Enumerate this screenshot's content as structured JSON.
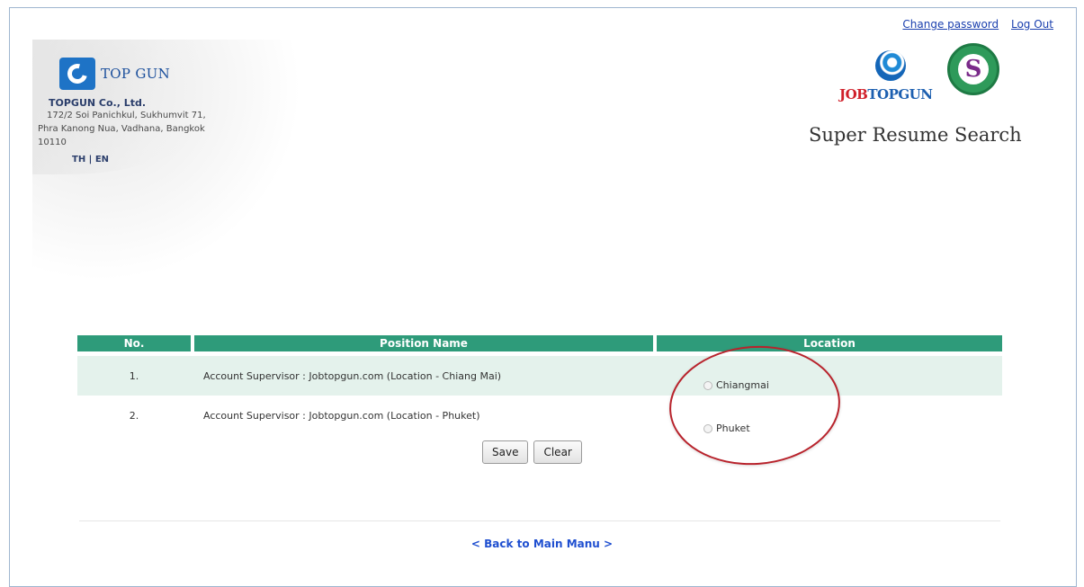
{
  "top_links": {
    "change_password": "Change password",
    "logout": "Log Out"
  },
  "company": {
    "logo_text": "TOP GUN",
    "name": "TOPGUN Co., Ltd.",
    "address_lines": [
      "172/2 Soi Panichkul, Sukhumvit 71,",
      "Phra Kanong Nua, Vadhana, Bangkok",
      "10110"
    ],
    "lang_th": "TH",
    "lang_sep": " | ",
    "lang_en": "EN"
  },
  "brand": {
    "job": "JOB",
    "topgun": "TOPGUN",
    "badge_letter": "S",
    "title": "Super Resume Search"
  },
  "table": {
    "headers": {
      "no": "No.",
      "position": "Position Name",
      "location": "Location"
    },
    "rows": [
      {
        "no": "1.",
        "position": "Account Supervisor : Jobtopgun.com (Location - Chiang Mai)"
      },
      {
        "no": "2.",
        "position": "Account Supervisor : Jobtopgun.com (Location - Phuket)"
      }
    ],
    "location_options": [
      {
        "label": "Chiangmai",
        "selected": false
      },
      {
        "label": "Phuket",
        "selected": false
      }
    ]
  },
  "buttons": {
    "save": "Save",
    "clear": "Clear"
  },
  "back_link": "< Back to Main Manu >",
  "colors": {
    "header_green": "#2e9b7a",
    "row_alt": "#e4f2ec",
    "link_blue": "#1f4fd0",
    "annotation_red": "#b8232c"
  }
}
